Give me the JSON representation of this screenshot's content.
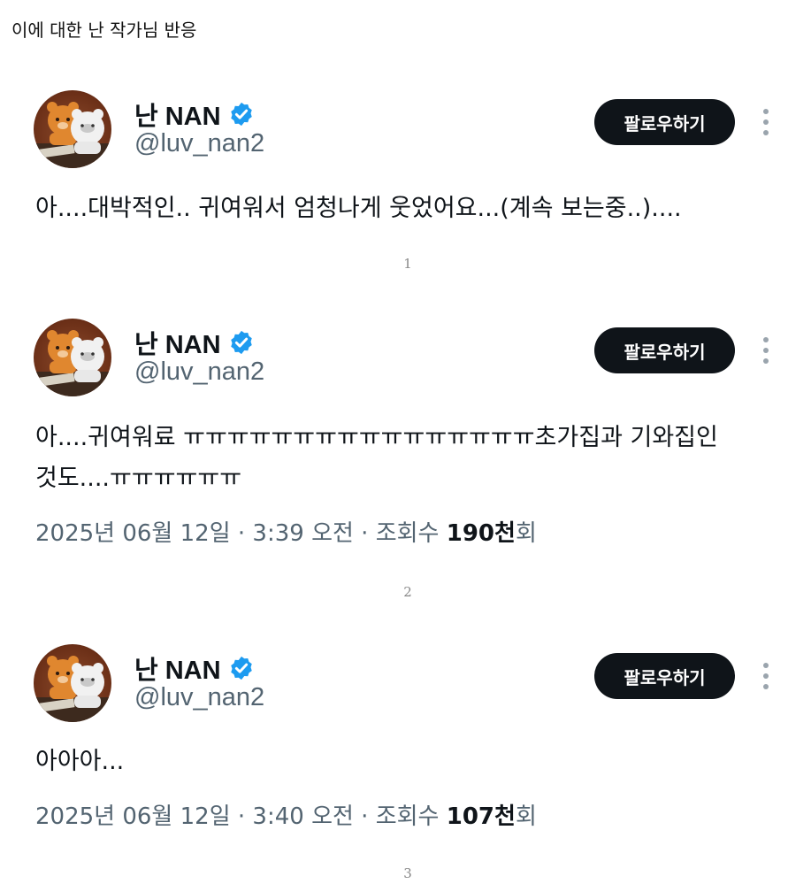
{
  "intro": "이에 대한 난 작가님 반응",
  "colors": {
    "verified": "#1d9bf0",
    "button_bg": "#0f1419",
    "muted": "#536471"
  },
  "tweets": [
    {
      "name": "난 NAN",
      "handle": "@luv_nan2",
      "follow_label": "팔로우하기",
      "lines": [
        "아....대박적인.. 귀여워서 엄청나게 웃었어요...(계속 보는중..)...."
      ],
      "date_time": "",
      "views_label": "",
      "views_count": "",
      "views_suffix": "",
      "page": "1"
    },
    {
      "name": "난 NAN",
      "handle": "@luv_nan2",
      "follow_label": "팔로우하기",
      "lines": [
        "아....귀여워료 ㅠㅠㅠㅠㅠㅠㅠㅠㅠㅠㅠㅠㅠㅠㅠㅠ초가집과 기와집인",
        "것도....ㅠㅠㅠㅠㅠㅠ"
      ],
      "date_time": "2025년 06월 12일 · 3:39 오전 · ",
      "views_label": "조회수 ",
      "views_count": "190천",
      "views_suffix": "회",
      "page": "2"
    },
    {
      "name": "난 NAN",
      "handle": "@luv_nan2",
      "follow_label": "팔로우하기",
      "lines": [
        "아아아..."
      ],
      "date_time": "2025년 06월 12일 · 3:40 오전 · ",
      "views_label": "조회수 ",
      "views_count": "107천",
      "views_suffix": "회",
      "page": "3"
    }
  ]
}
